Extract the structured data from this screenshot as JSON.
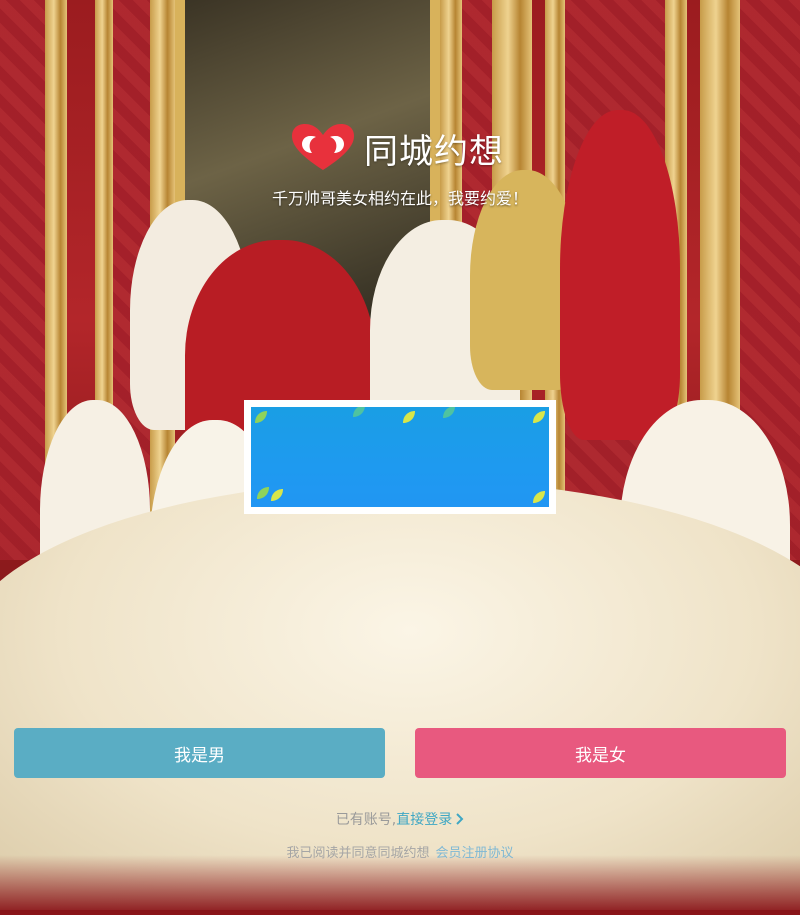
{
  "brand": {
    "name": "同城约想",
    "logo_icon": "heart-logo-icon",
    "tagline": "千万帅哥美女相约在此，我要约爱！",
    "accent_color": "#e8313c"
  },
  "background": {
    "type": "wedding-photo"
  },
  "banner": {
    "background_color": "#1e9af0",
    "decoration": "leaf-icon"
  },
  "buttons": {
    "male_label": "我是男",
    "male_color": "#5aadc4",
    "female_label": "我是女",
    "female_color": "#e8597f"
  },
  "login": {
    "prompt": "已有账号,",
    "link_label": "直接登录",
    "link_icon": "chevron-right-icon",
    "link_color": "#3fa7c4"
  },
  "agreement": {
    "prompt": "我已阅读并同意同城约想",
    "link_label": "会员注册协议",
    "link_color": "#7fb8d4"
  }
}
